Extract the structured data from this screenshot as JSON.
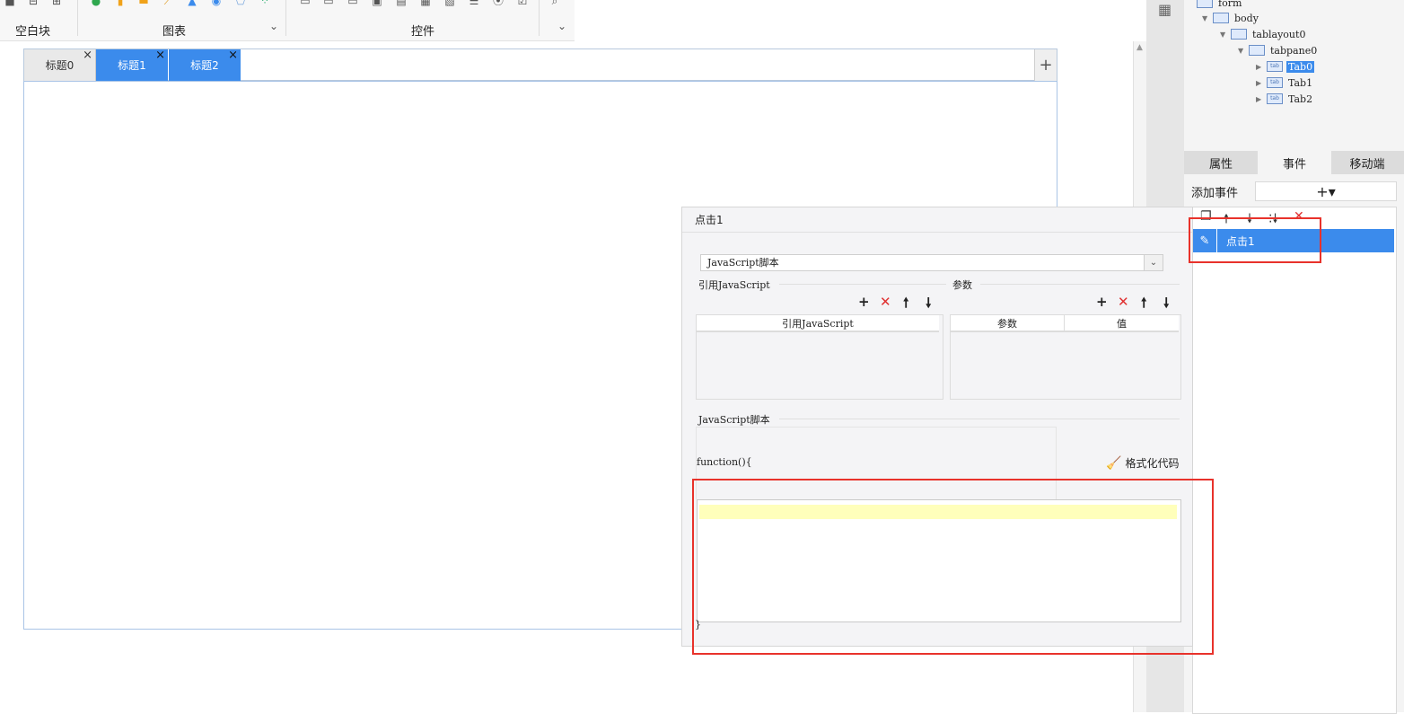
{
  "toolbar": {
    "groups": [
      {
        "label": "空白块"
      },
      {
        "label": "图表"
      },
      {
        "label": "控件"
      }
    ]
  },
  "canvas": {
    "tabs": [
      {
        "label": "标题0",
        "close": "×"
      },
      {
        "label": "标题1",
        "close": "×"
      },
      {
        "label": "标题2",
        "close": "×"
      }
    ],
    "add_tab": "+"
  },
  "tree": {
    "nodes": [
      {
        "label": "form"
      },
      {
        "label": "body"
      },
      {
        "label": "tablayout0"
      },
      {
        "label": "tabpane0"
      },
      {
        "label": "Tab0",
        "selected": true
      },
      {
        "label": "Tab1"
      },
      {
        "label": "Tab2"
      }
    ]
  },
  "panel": {
    "tabs": [
      {
        "label": "属性"
      },
      {
        "label": "事件",
        "active": true
      },
      {
        "label": "移动端"
      }
    ],
    "add_event_label": "添加事件",
    "add_event_btn": "+▾",
    "events": [
      {
        "label": "点击1",
        "selected": true
      }
    ]
  },
  "dialog": {
    "title": "点击1",
    "type_select": "JavaScript脚本",
    "ref_section": "引用JavaScript",
    "param_section": "参数",
    "ref_col": "引用JavaScript",
    "param_cols": [
      "参数",
      "值"
    ],
    "script_section": "JavaScript脚本",
    "fn_open": "function(){",
    "fn_close": "}",
    "format_btn": "格式化代码"
  },
  "colors": {
    "accent": "#3b8bec",
    "danger": "#e03030",
    "annotation": "#e8322b",
    "editor_highlight": "#ffffbb"
  }
}
